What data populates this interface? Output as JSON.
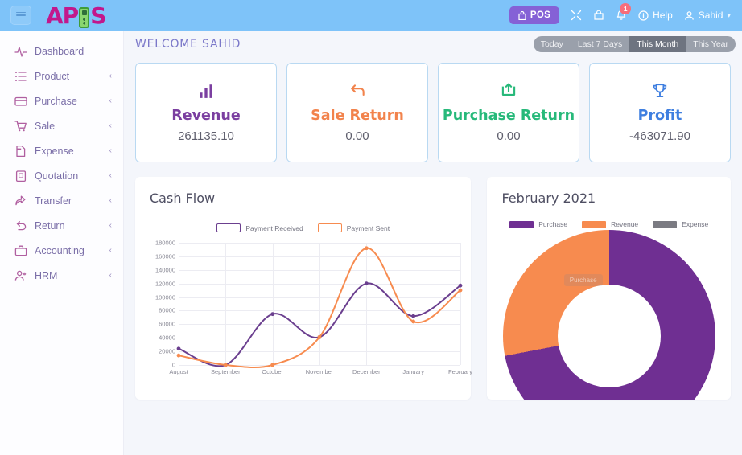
{
  "header": {
    "menu_icon": "hamburger-icon",
    "logo_text_left": "AP",
    "logo_text_right": "S",
    "pos_label": "POS",
    "pos_icon": "bag-icon",
    "expand_icon": "expand-icon",
    "cart_icon": "shopping-bag-icon",
    "bell_icon": "bell-icon",
    "bell_badge": "1",
    "help_label": "Help",
    "help_icon": "info-circle-icon",
    "user_name": "Sahid",
    "user_icon": "user-icon",
    "caret_icon": "chevron-down-icon",
    "bg_color": "#7ec3f9",
    "pos_color": "#8561d6",
    "badge_color": "#f76d7a"
  },
  "sidebar": {
    "items": [
      {
        "label": "Dashboard",
        "icon": "activity-icon",
        "has_chevron": false
      },
      {
        "label": "Product",
        "icon": "list-icon",
        "has_chevron": true
      },
      {
        "label": "Purchase",
        "icon": "credit-card-icon",
        "has_chevron": true
      },
      {
        "label": "Sale",
        "icon": "cart-icon",
        "has_chevron": true
      },
      {
        "label": "Expense",
        "icon": "file-icon",
        "has_chevron": true
      },
      {
        "label": "Quotation",
        "icon": "clipboard-icon",
        "has_chevron": true
      },
      {
        "label": "Transfer",
        "icon": "share-icon",
        "has_chevron": true
      },
      {
        "label": "Return",
        "icon": "undo-icon",
        "has_chevron": true
      },
      {
        "label": "Accounting",
        "icon": "briefcase-icon",
        "has_chevron": true
      },
      {
        "label": "HRM",
        "icon": "users-icon",
        "has_chevron": true
      }
    ],
    "chevron_glyph": "‹"
  },
  "main": {
    "welcome_title": "WELCOME SAHID",
    "filters": [
      {
        "label": "Today",
        "active": false
      },
      {
        "label": "Last 7 Days",
        "active": false
      },
      {
        "label": "This Month",
        "active": true
      },
      {
        "label": "This Year",
        "active": false
      }
    ],
    "cards": [
      {
        "title": "Revenue",
        "value": "261135.10",
        "icon": "bar-chart-icon",
        "color": "#7b3fa0"
      },
      {
        "title": "Sale Return",
        "value": "0.00",
        "icon": "return-arrow-icon",
        "color": "#f2834c"
      },
      {
        "title": "Purchase Return",
        "value": "0.00",
        "icon": "refresh-box-icon",
        "color": "#27b97a"
      },
      {
        "title": "Profit",
        "value": "-463071.90",
        "icon": "trophy-icon",
        "color": "#3f7fe0"
      }
    ]
  },
  "chart_data": [
    {
      "type": "line",
      "title": "Cash Flow",
      "categories": [
        "August",
        "September",
        "October",
        "November",
        "December",
        "January",
        "February"
      ],
      "series": [
        {
          "name": "Payment Received",
          "color": "#6b3f8f",
          "values": [
            24000,
            0,
            75000,
            41000,
            120000,
            72000,
            117000
          ]
        },
        {
          "name": "Payment Sent",
          "color": "#f78b4f",
          "values": [
            14000,
            0,
            0,
            41000,
            172000,
            64000,
            110000
          ]
        }
      ],
      "yticks": [
        0,
        20000,
        40000,
        60000,
        80000,
        100000,
        120000,
        140000,
        160000,
        180000
      ],
      "ylim": [
        0,
        180000
      ],
      "xlabel": "",
      "ylabel": "",
      "grid": true,
      "legend_position": "top"
    },
    {
      "type": "pie",
      "title": "February 2021",
      "labels": [
        "Purchase",
        "Revenue",
        "Expense"
      ],
      "colors": [
        "#6f2f92",
        "#f78b4f",
        "#7b7b82"
      ],
      "values": [
        72,
        28,
        0
      ],
      "donut": true,
      "tooltip_text": "Purchase",
      "legend_position": "top"
    }
  ]
}
